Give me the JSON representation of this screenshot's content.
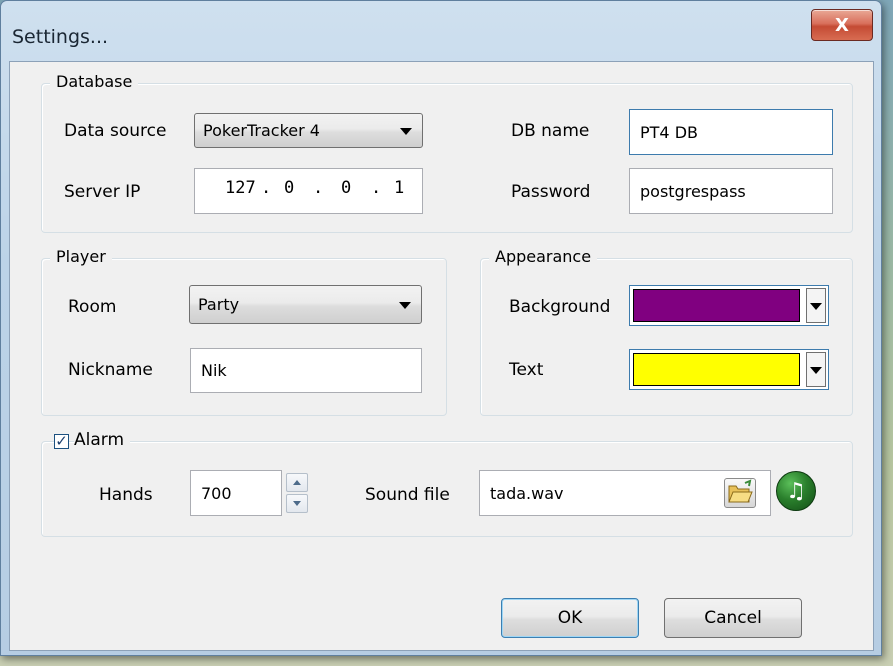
{
  "window": {
    "title": "Settings...",
    "close_label": "X"
  },
  "database": {
    "group_label": "Database",
    "data_source_label": "Data source",
    "data_source_value": "PokerTracker 4",
    "server_ip_label": "Server IP",
    "server_ip": [
      "127",
      "0",
      "0",
      "1"
    ],
    "db_name_label": "DB name",
    "db_name_value": "PT4 DB",
    "password_label": "Password",
    "password_value": "postgrespass"
  },
  "player": {
    "group_label": "Player",
    "room_label": "Room",
    "room_value": "Party",
    "nickname_label": "Nickname",
    "nickname_value": "Nik"
  },
  "appearance": {
    "group_label": "Appearance",
    "background_label": "Background",
    "background_color": "#800080",
    "text_label": "Text",
    "text_color": "#ffff00"
  },
  "alarm": {
    "checkbox_label": "Alarm",
    "checked": true,
    "hands_label": "Hands",
    "hands_value": "700",
    "sound_file_label": "Sound file",
    "sound_file_value": "tada.wav"
  },
  "buttons": {
    "ok_label": "OK",
    "cancel_label": "Cancel"
  },
  "icons": {
    "folder": "folder-open-icon",
    "music": "music-note-icon",
    "close": "close-icon"
  }
}
